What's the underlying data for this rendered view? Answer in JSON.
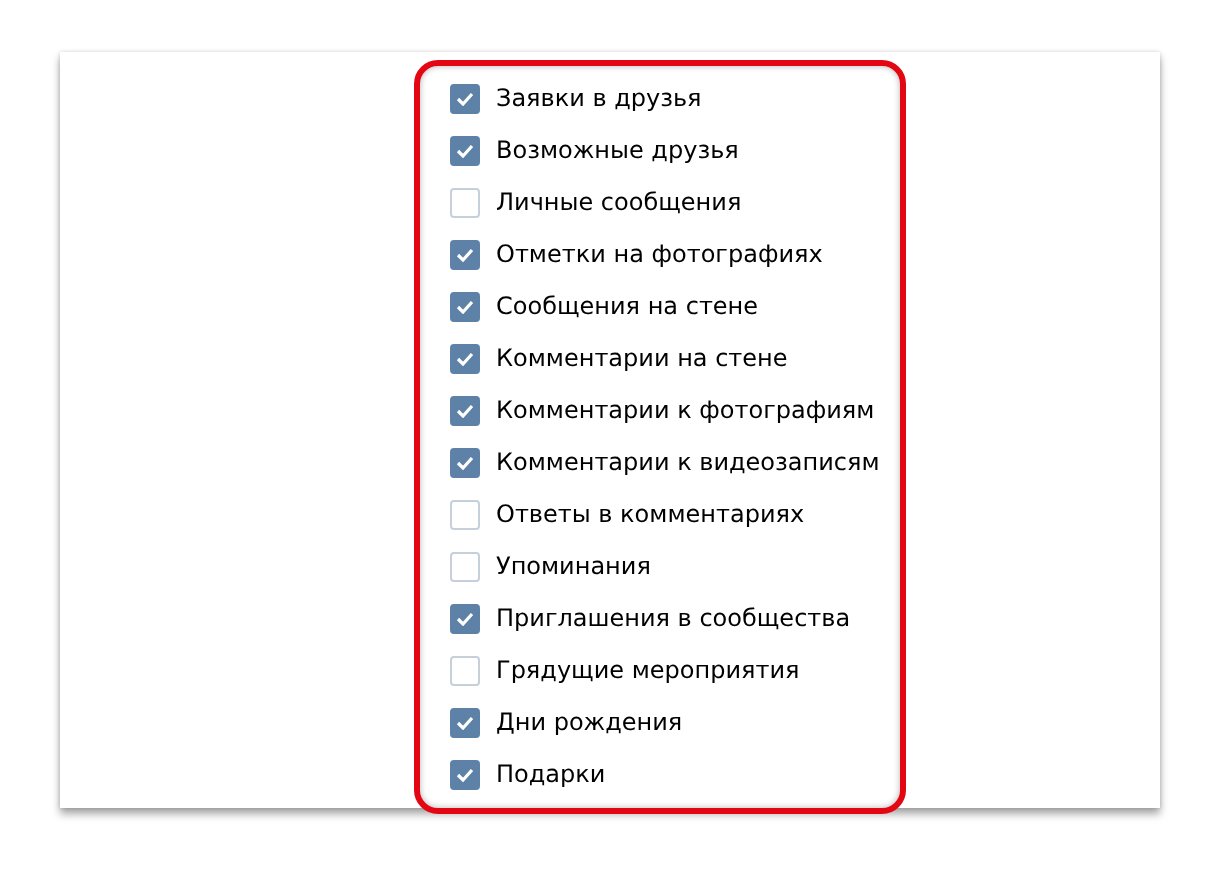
{
  "options": [
    {
      "label": "Заявки в друзья",
      "checked": true
    },
    {
      "label": "Возможные друзья",
      "checked": true
    },
    {
      "label": "Личные сообщения",
      "checked": false
    },
    {
      "label": "Отметки на фотографиях",
      "checked": true
    },
    {
      "label": "Сообщения на стене",
      "checked": true
    },
    {
      "label": "Комментарии на стене",
      "checked": true
    },
    {
      "label": "Комментарии к фотографиям",
      "checked": true
    },
    {
      "label": "Комментарии к видеозаписям",
      "checked": true
    },
    {
      "label": "Ответы в комментариях",
      "checked": false
    },
    {
      "label": "Упоминания",
      "checked": false
    },
    {
      "label": "Приглашения в сообщества",
      "checked": true
    },
    {
      "label": "Грядущие мероприятия",
      "checked": false
    },
    {
      "label": "Дни рождения",
      "checked": true
    },
    {
      "label": "Подарки",
      "checked": true
    }
  ]
}
